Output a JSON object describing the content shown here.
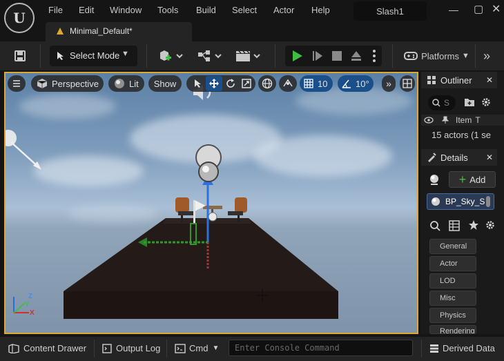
{
  "menu": {
    "items": [
      "File",
      "Edit",
      "Window",
      "Tools",
      "Build",
      "Select",
      "Actor",
      "Help"
    ],
    "project": "Slash1"
  },
  "tab": {
    "label": "Minimal_Default*"
  },
  "toolbar": {
    "select_mode": "Select Mode",
    "platforms": "Platforms"
  },
  "viewport": {
    "perspective": "Perspective",
    "lit": "Lit",
    "show": "Show",
    "grid_snap": "10",
    "rotation_snap": "10°",
    "axis_x": "X",
    "axis_y": "Y",
    "axis_z": "Z"
  },
  "outliner": {
    "title": "Outliner",
    "search_placeholder": "S",
    "col_item": "Item",
    "col_type": "T",
    "actor_count": "15 actors (1 se"
  },
  "details": {
    "title": "Details",
    "add_label": "Add",
    "actor_name": "BP_Sky_S",
    "categories": [
      "General",
      "Actor",
      "LOD",
      "Misc",
      "Physics",
      "Rendering"
    ]
  },
  "bottom": {
    "content_drawer": "Content Drawer",
    "output_log": "Output Log",
    "cmd": "Cmd",
    "console_placeholder": "Enter Console Command",
    "derived_data": "Derived Data"
  },
  "colors": {
    "accent": "#e0a82e",
    "play": "#3fbf3f",
    "blue": "#1a4f8a"
  }
}
